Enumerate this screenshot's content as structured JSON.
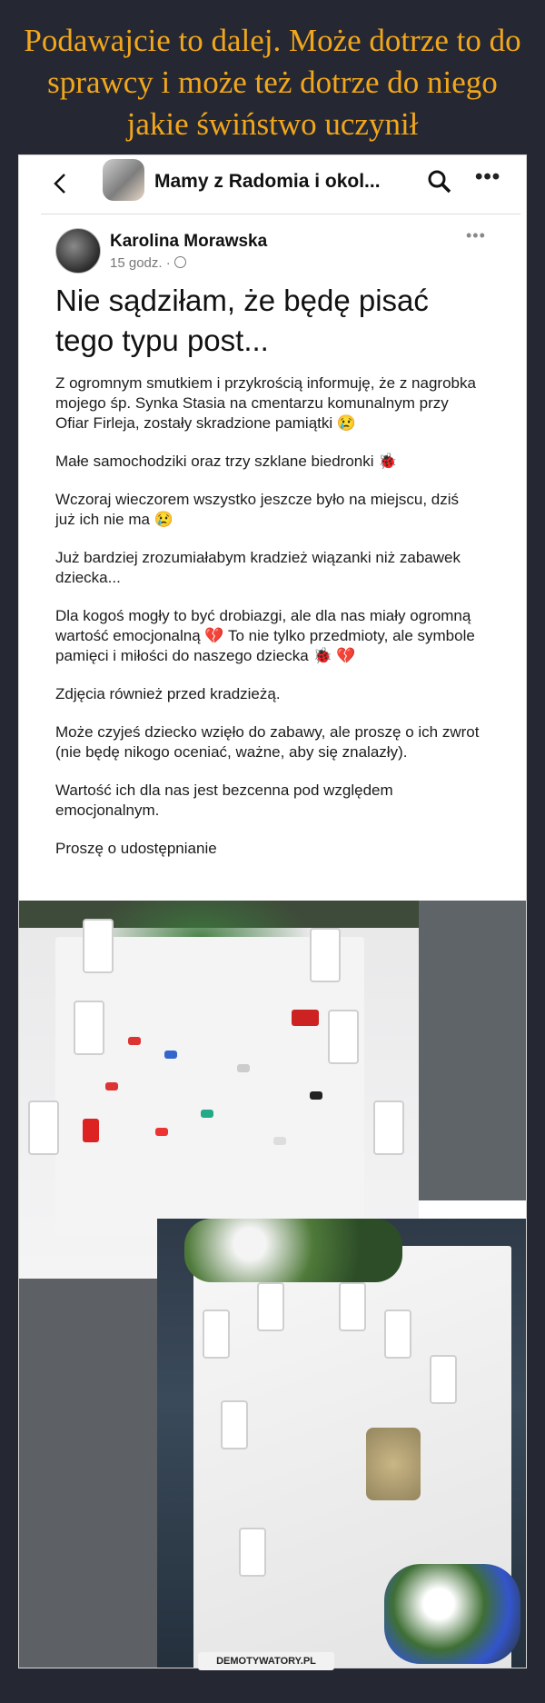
{
  "meme": {
    "title": "Podawajcie to dalej. Może dotrze to do sprawcy i może też dotrze do niego jakie świństwo uczynił",
    "watermark": "DEMOTYWATORY.PL"
  },
  "topbar": {
    "group_name": "Mamy z Radomia i okol...",
    "more": "•••"
  },
  "post": {
    "author": "Karolina Morawska",
    "time": "15 godz. · ",
    "more": "•••",
    "heading": "Nie sądziłam, że będę pisać tego typu post...",
    "paragraphs": [
      "Z ogromnym smutkiem i przykrością informuję, że z nagrobka mojego śp. Synka Stasia na cmentarzu komunalnym przy Ofiar Firleja, zostały skradzione pamiątki 😢",
      "Małe samochodziki oraz trzy szklane biedronki 🐞",
      "Wczoraj wieczorem wszystko jeszcze było na miejscu, dziś już ich nie ma 😢",
      "Już bardziej zrozumiałabym kradzież wiązanki niż zabawek dziecka...",
      "Dla kogoś mogły to być drobiazgi, ale dla nas miały ogromną wartość emocjonalną 💔 To nie tylko przedmioty, ale symbole pamięci i miłości do naszego dziecka 🐞 💔",
      "Zdjęcia również przed kradzieżą.",
      "Może czyjeś dziecko wzięło do zabawy, ale proszę o ich zwrot (nie będę nikogo oceniać, ważne, aby się znalazły).",
      "Wartość ich dla nas jest bezcenna pod względem emocjonalnym.",
      "Proszę o udostępnianie"
    ]
  },
  "colors": {
    "background": "#252833",
    "title": "#f2a71b"
  }
}
